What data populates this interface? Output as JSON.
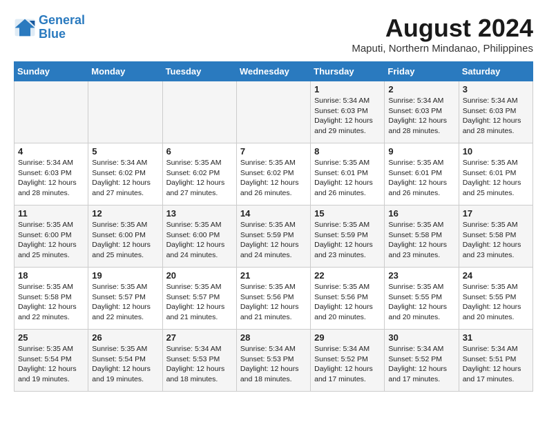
{
  "logo": {
    "line1": "General",
    "line2": "Blue"
  },
  "title": "August 2024",
  "subtitle": "Maputi, Northern Mindanao, Philippines",
  "days_of_week": [
    "Sunday",
    "Monday",
    "Tuesday",
    "Wednesday",
    "Thursday",
    "Friday",
    "Saturday"
  ],
  "weeks": [
    [
      {
        "day": "",
        "info": ""
      },
      {
        "day": "",
        "info": ""
      },
      {
        "day": "",
        "info": ""
      },
      {
        "day": "",
        "info": ""
      },
      {
        "day": "1",
        "info": "Sunrise: 5:34 AM\nSunset: 6:03 PM\nDaylight: 12 hours\nand 29 minutes."
      },
      {
        "day": "2",
        "info": "Sunrise: 5:34 AM\nSunset: 6:03 PM\nDaylight: 12 hours\nand 28 minutes."
      },
      {
        "day": "3",
        "info": "Sunrise: 5:34 AM\nSunset: 6:03 PM\nDaylight: 12 hours\nand 28 minutes."
      }
    ],
    [
      {
        "day": "4",
        "info": "Sunrise: 5:34 AM\nSunset: 6:03 PM\nDaylight: 12 hours\nand 28 minutes."
      },
      {
        "day": "5",
        "info": "Sunrise: 5:34 AM\nSunset: 6:02 PM\nDaylight: 12 hours\nand 27 minutes."
      },
      {
        "day": "6",
        "info": "Sunrise: 5:35 AM\nSunset: 6:02 PM\nDaylight: 12 hours\nand 27 minutes."
      },
      {
        "day": "7",
        "info": "Sunrise: 5:35 AM\nSunset: 6:02 PM\nDaylight: 12 hours\nand 26 minutes."
      },
      {
        "day": "8",
        "info": "Sunrise: 5:35 AM\nSunset: 6:01 PM\nDaylight: 12 hours\nand 26 minutes."
      },
      {
        "day": "9",
        "info": "Sunrise: 5:35 AM\nSunset: 6:01 PM\nDaylight: 12 hours\nand 26 minutes."
      },
      {
        "day": "10",
        "info": "Sunrise: 5:35 AM\nSunset: 6:01 PM\nDaylight: 12 hours\nand 25 minutes."
      }
    ],
    [
      {
        "day": "11",
        "info": "Sunrise: 5:35 AM\nSunset: 6:00 PM\nDaylight: 12 hours\nand 25 minutes."
      },
      {
        "day": "12",
        "info": "Sunrise: 5:35 AM\nSunset: 6:00 PM\nDaylight: 12 hours\nand 25 minutes."
      },
      {
        "day": "13",
        "info": "Sunrise: 5:35 AM\nSunset: 6:00 PM\nDaylight: 12 hours\nand 24 minutes."
      },
      {
        "day": "14",
        "info": "Sunrise: 5:35 AM\nSunset: 5:59 PM\nDaylight: 12 hours\nand 24 minutes."
      },
      {
        "day": "15",
        "info": "Sunrise: 5:35 AM\nSunset: 5:59 PM\nDaylight: 12 hours\nand 23 minutes."
      },
      {
        "day": "16",
        "info": "Sunrise: 5:35 AM\nSunset: 5:58 PM\nDaylight: 12 hours\nand 23 minutes."
      },
      {
        "day": "17",
        "info": "Sunrise: 5:35 AM\nSunset: 5:58 PM\nDaylight: 12 hours\nand 23 minutes."
      }
    ],
    [
      {
        "day": "18",
        "info": "Sunrise: 5:35 AM\nSunset: 5:58 PM\nDaylight: 12 hours\nand 22 minutes."
      },
      {
        "day": "19",
        "info": "Sunrise: 5:35 AM\nSunset: 5:57 PM\nDaylight: 12 hours\nand 22 minutes."
      },
      {
        "day": "20",
        "info": "Sunrise: 5:35 AM\nSunset: 5:57 PM\nDaylight: 12 hours\nand 21 minutes."
      },
      {
        "day": "21",
        "info": "Sunrise: 5:35 AM\nSunset: 5:56 PM\nDaylight: 12 hours\nand 21 minutes."
      },
      {
        "day": "22",
        "info": "Sunrise: 5:35 AM\nSunset: 5:56 PM\nDaylight: 12 hours\nand 20 minutes."
      },
      {
        "day": "23",
        "info": "Sunrise: 5:35 AM\nSunset: 5:55 PM\nDaylight: 12 hours\nand 20 minutes."
      },
      {
        "day": "24",
        "info": "Sunrise: 5:35 AM\nSunset: 5:55 PM\nDaylight: 12 hours\nand 20 minutes."
      }
    ],
    [
      {
        "day": "25",
        "info": "Sunrise: 5:35 AM\nSunset: 5:54 PM\nDaylight: 12 hours\nand 19 minutes."
      },
      {
        "day": "26",
        "info": "Sunrise: 5:35 AM\nSunset: 5:54 PM\nDaylight: 12 hours\nand 19 minutes."
      },
      {
        "day": "27",
        "info": "Sunrise: 5:34 AM\nSunset: 5:53 PM\nDaylight: 12 hours\nand 18 minutes."
      },
      {
        "day": "28",
        "info": "Sunrise: 5:34 AM\nSunset: 5:53 PM\nDaylight: 12 hours\nand 18 minutes."
      },
      {
        "day": "29",
        "info": "Sunrise: 5:34 AM\nSunset: 5:52 PM\nDaylight: 12 hours\nand 17 minutes."
      },
      {
        "day": "30",
        "info": "Sunrise: 5:34 AM\nSunset: 5:52 PM\nDaylight: 12 hours\nand 17 minutes."
      },
      {
        "day": "31",
        "info": "Sunrise: 5:34 AM\nSunset: 5:51 PM\nDaylight: 12 hours\nand 17 minutes."
      }
    ]
  ]
}
